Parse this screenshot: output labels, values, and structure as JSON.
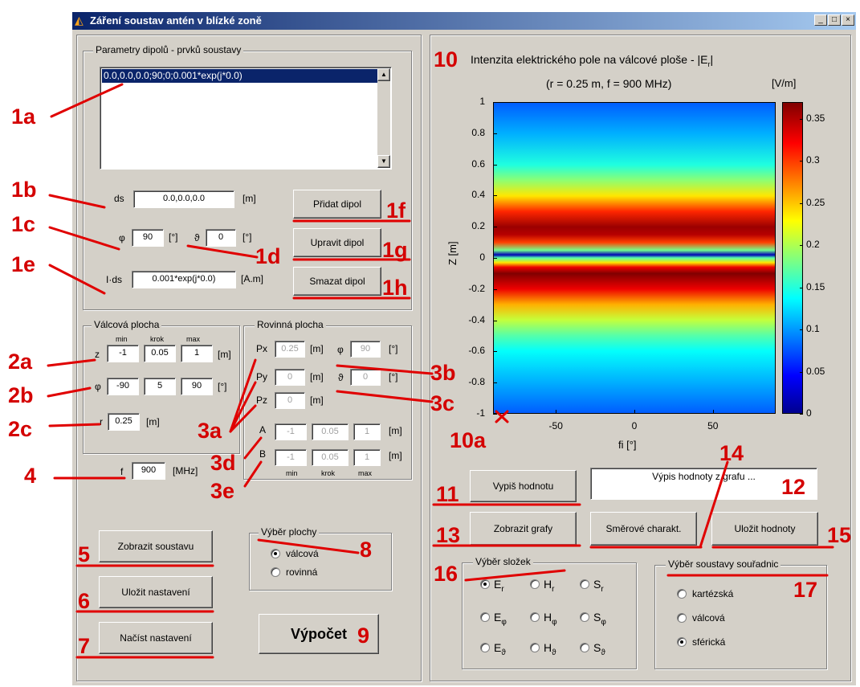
{
  "window": {
    "title": "Záření soustav antén v blízké zoně",
    "controls": [
      "_",
      "□",
      "×"
    ]
  },
  "dipoles": {
    "legend": "Parametry dipolů - prvků soustavy",
    "list": [
      "0.0,0.0,0.0;90;0;0.001*exp(j*0.0)"
    ],
    "ds_label": "ds",
    "ds_value": "0.0,0.0,0.0",
    "ds_unit": "[m]",
    "phi_label": "φ",
    "phi_value": "90",
    "phi_unit": "[°]",
    "theta_label": "ϑ",
    "theta_value": "0",
    "theta_unit": "[°]",
    "ids_label": "I·ds",
    "ids_value": "0.001*exp(j*0.0)",
    "ids_unit": "[A.m]",
    "add_button": "Přidat dipol",
    "edit_button": "Upravit dipol",
    "delete_button": "Smazat dipol"
  },
  "cyl": {
    "legend": "Válcová plocha",
    "headers": [
      "min",
      "krok",
      "max"
    ],
    "z_label": "z",
    "z_values": [
      "-1",
      "0.05",
      "1"
    ],
    "z_unit": "[m]",
    "phi_label": "φ",
    "phi_values": [
      "-90",
      "5",
      "90"
    ],
    "phi_unit": "[°]",
    "r_label": "r",
    "r_value": "0.25",
    "r_unit": "[m]"
  },
  "plane": {
    "legend": "Rovinná plocha",
    "px_label": "Px",
    "px_value": "0.25",
    "px_unit": "[m]",
    "py_label": "Py",
    "py_value": "0",
    "py_unit": "[m]",
    "pz_label": "Pz",
    "pz_value": "0",
    "pz_unit": "[m]",
    "phi_label": "φ",
    "phi_value": "90",
    "phi_unit": "[°]",
    "theta_label": "ϑ",
    "theta_value": "0",
    "theta_unit": "[°]",
    "a_label": "A",
    "a_values": [
      "-1",
      "0.05",
      "1"
    ],
    "a_unit": "[m]",
    "b_label": "B",
    "b_values": [
      "-1",
      "0.05",
      "1"
    ],
    "b_unit": "[m]",
    "footers": [
      "min",
      "krok",
      "max"
    ]
  },
  "freq": {
    "label": "f",
    "value": "900",
    "unit": "[MHz]"
  },
  "left_buttons": {
    "show": "Zobrazit soustavu",
    "save": "Uložit nastavení",
    "load": "Načíst nastavení"
  },
  "surface": {
    "legend": "Výběr plochy",
    "options": [
      "válcová",
      "rovinná"
    ],
    "selected": "válcová"
  },
  "compute": "Výpočet",
  "plot": {
    "title": "Intenzita elektrického pole na válcové ploše -  |E",
    "title_sub": "r",
    "title_end": "|",
    "subtitle": "(r = 0.25 m, f = 900 MHz)",
    "unit": "[V/m]",
    "colorbar_ticks": [
      "0.35",
      "0.3",
      "0.25",
      "0.2",
      "0.15",
      "0.1",
      "0.05",
      "0"
    ]
  },
  "chart_data": {
    "type": "heatmap",
    "title": "Intenzita elektrického pole na válcové ploše - |Er|",
    "subtitle": "(r = 0.25 m, f = 900 MHz)",
    "xlabel": "fi [°]",
    "ylabel": "Z [m]",
    "xlim": [
      -90,
      90
    ],
    "ylim": [
      -1,
      1
    ],
    "xticks": [
      "-50",
      "0",
      "50"
    ],
    "yticks": [
      "1",
      "0.8",
      "0.6",
      "0.4",
      "0.2",
      "0",
      "-0.2",
      "-0.4",
      "-0.6",
      "-0.8",
      "-1"
    ],
    "colorbar_label": "[V/m]",
    "clim": [
      0,
      0.37
    ],
    "z_profile": [
      {
        "z": 1.0,
        "v": 0.08
      },
      {
        "z": 0.8,
        "v": 0.11
      },
      {
        "z": 0.6,
        "v": 0.15
      },
      {
        "z": 0.5,
        "v": 0.19
      },
      {
        "z": 0.4,
        "v": 0.24
      },
      {
        "z": 0.3,
        "v": 0.31
      },
      {
        "z": 0.2,
        "v": 0.36
      },
      {
        "z": 0.15,
        "v": 0.35
      },
      {
        "z": 0.1,
        "v": 0.3
      },
      {
        "z": 0.05,
        "v": 0.18
      },
      {
        "z": 0.02,
        "v": 0.02
      },
      {
        "z": 0.0,
        "v": 0.17
      },
      {
        "z": -0.03,
        "v": 0.24
      },
      {
        "z": -0.06,
        "v": 0.33
      },
      {
        "z": -0.1,
        "v": 0.37
      },
      {
        "z": -0.2,
        "v": 0.33
      },
      {
        "z": -0.3,
        "v": 0.26
      },
      {
        "z": -0.4,
        "v": 0.21
      },
      {
        "z": -0.5,
        "v": 0.17
      },
      {
        "z": -0.6,
        "v": 0.14
      },
      {
        "z": -0.8,
        "v": 0.11
      },
      {
        "z": -1.0,
        "v": 0.08
      }
    ]
  },
  "right": {
    "print_button": "Vypiš hodnotu",
    "readout": "Výpis hodnoty z grafu ...",
    "show_graphs": "Zobrazit grafy",
    "directional": "Směrové charakt.",
    "save_values": "Uložit hodnoty"
  },
  "components": {
    "legend": "Výběr složek",
    "items": [
      {
        "letter": "E",
        "sub": "r"
      },
      {
        "letter": "H",
        "sub": "r"
      },
      {
        "letter": "S",
        "sub": "r"
      },
      {
        "letter": "E",
        "sub": "φ"
      },
      {
        "letter": "H",
        "sub": "φ"
      },
      {
        "letter": "S",
        "sub": "φ"
      },
      {
        "letter": "E",
        "sub": "ϑ"
      },
      {
        "letter": "H",
        "sub": "ϑ"
      },
      {
        "letter": "S",
        "sub": "ϑ"
      }
    ],
    "selected": 0
  },
  "coords": {
    "legend": "Výběr soustavy souřadnic",
    "options": [
      "kartézská",
      "válcová",
      "sférická"
    ],
    "selected": "sférická"
  },
  "annotations": [
    "1a",
    "1b",
    "1c",
    "1d",
    "1e",
    "1f",
    "1g",
    "1h",
    "2a",
    "2b",
    "2c",
    "3a",
    "3b",
    "3c",
    "3d",
    "3e",
    "4",
    "5",
    "6",
    "7",
    "8",
    "9",
    "10",
    "10a",
    "11",
    "12",
    "13",
    "14",
    "15",
    "16",
    "17"
  ],
  "colors": {
    "annotation": "#d40000",
    "title_bar": "#0a246a",
    "face": "#d4d0c8"
  }
}
